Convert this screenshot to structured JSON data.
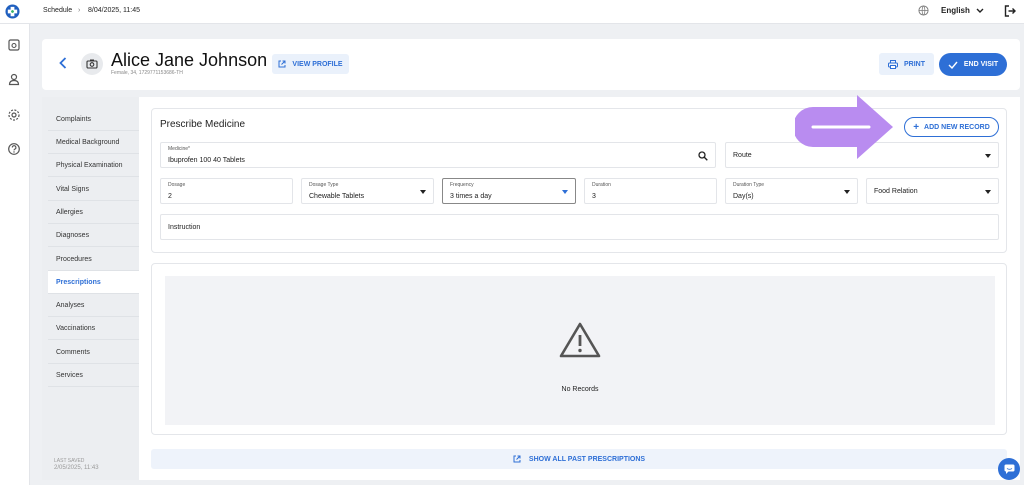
{
  "topbar": {
    "breadcrumb": "Schedule",
    "datetime": "8/04/2025, 11:45",
    "language": "English",
    "icons": [
      "app-logo-icon",
      "chevron-right-icon",
      "globe-icon",
      "chevron-down-icon",
      "logout-icon"
    ]
  },
  "sidenav": {
    "icons": [
      "calendar-icon",
      "user-icon",
      "settings-icon",
      "help-icon"
    ]
  },
  "patient": {
    "name": "Alice Jane Johnson",
    "subtitle": "Female, 34, 1729771153686-TH",
    "view_profile": "VIEW PROFILE",
    "print": "PRINT",
    "end_visit": "END VISIT"
  },
  "menu": {
    "items": [
      "Complaints",
      "Medical Background",
      "Physical Examination",
      "Vital Signs",
      "Allergies",
      "Diagnoses",
      "Procedures",
      "Prescriptions",
      "Analyses",
      "Vaccinations",
      "Comments",
      "Services"
    ],
    "active": "Prescriptions",
    "last_saved_label": "LAST SAVED",
    "last_saved_value": "2/05/2025, 11:43"
  },
  "prescribe": {
    "title": "Prescribe Medicine",
    "add_button": "ADD NEW RECORD",
    "medicine": {
      "label": "Medicine*",
      "value": "Ibuprofen 100 40 Tablets"
    },
    "route": {
      "value": "Route"
    },
    "dosage": {
      "label": "Dosage",
      "value": "2"
    },
    "dosage_type": {
      "label": "Dosage Type",
      "value": "Chewable Tablets"
    },
    "frequency": {
      "label": "Frequency",
      "value": "3 times a day"
    },
    "duration": {
      "label": "Duration",
      "value": "3"
    },
    "duration_type": {
      "label": "Duration Type",
      "value": "Day(s)"
    },
    "food_relation": {
      "value": "Food Relation"
    },
    "instruction": {
      "value": "Instruction"
    }
  },
  "records": {
    "empty_text": "No Records",
    "show_all": "SHOW ALL PAST PRESCRIPTIONS"
  },
  "colors": {
    "accent": "#2e6fd6",
    "annotation_arrow": "#b98cf0"
  }
}
